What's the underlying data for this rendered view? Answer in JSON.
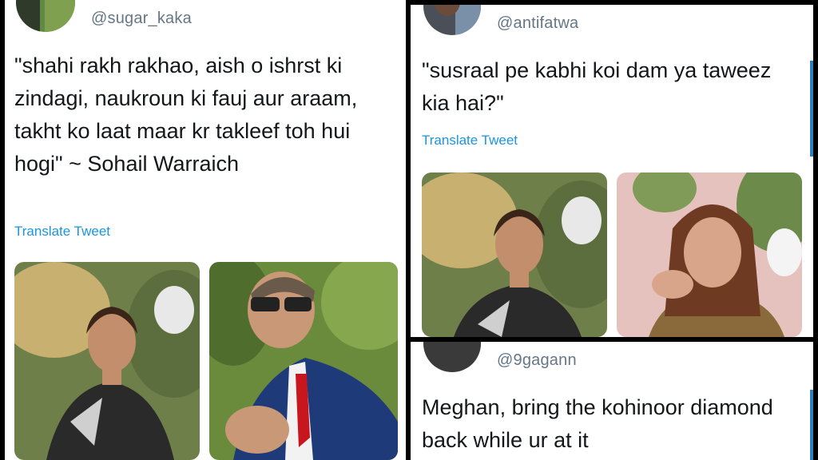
{
  "tweets": [
    {
      "handle": "@sugar_kaka",
      "text": "\"shahi rakh rakhao, aish o ishrst ki zindagi, naukroun ki fauj aur araam, takht ko laat maar kr takleef toh hui hogi\" ~ Sohail Warraich",
      "translate": "Translate Tweet"
    },
    {
      "handle": "@antifatwa",
      "text": "\"susraal pe kabhi koi dam ya taweez kia hai?\"",
      "translate": "Translate Tweet"
    },
    {
      "handle": "@9gagann",
      "text": "Meghan, bring the kohinoor diamond back while ur at it"
    }
  ],
  "colors": {
    "handle": "#657786",
    "text": "#14171a",
    "link": "#1b95e0",
    "background": "#000000"
  }
}
